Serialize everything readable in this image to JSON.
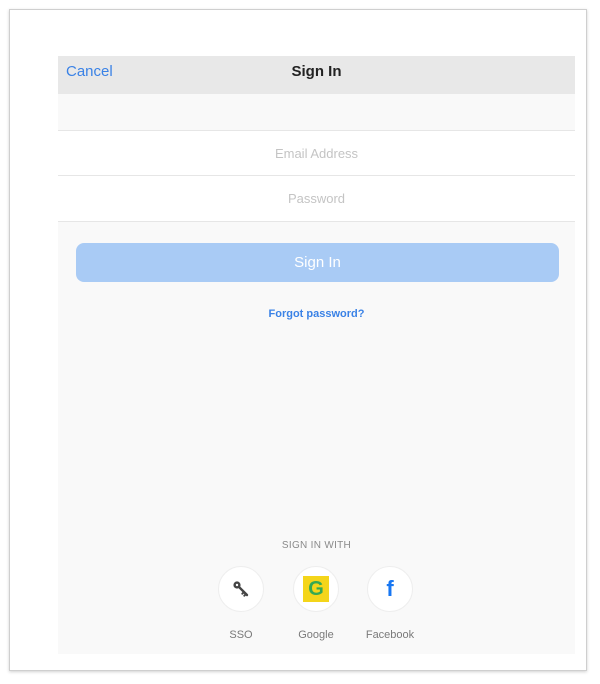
{
  "navbar": {
    "cancel_label": "Cancel",
    "title": "Sign In"
  },
  "form": {
    "email_placeholder": "Email Address",
    "email_value": "",
    "password_placeholder": "Password",
    "password_value": ""
  },
  "signin_button_label": "Sign In",
  "forgot_password_label": "Forgot password?",
  "sign_in_with_label": "SIGN IN WITH",
  "social": [
    {
      "label": "SSO",
      "icon": "key-icon"
    },
    {
      "label": "Google",
      "icon": "google-icon"
    },
    {
      "label": "Facebook",
      "icon": "facebook-icon"
    }
  ],
  "colors": {
    "accent": "#3a82e6",
    "button_disabled": "#a9cbf5",
    "navbar_bg": "#e8e8e8",
    "screen_bg": "#f9f9f9"
  }
}
